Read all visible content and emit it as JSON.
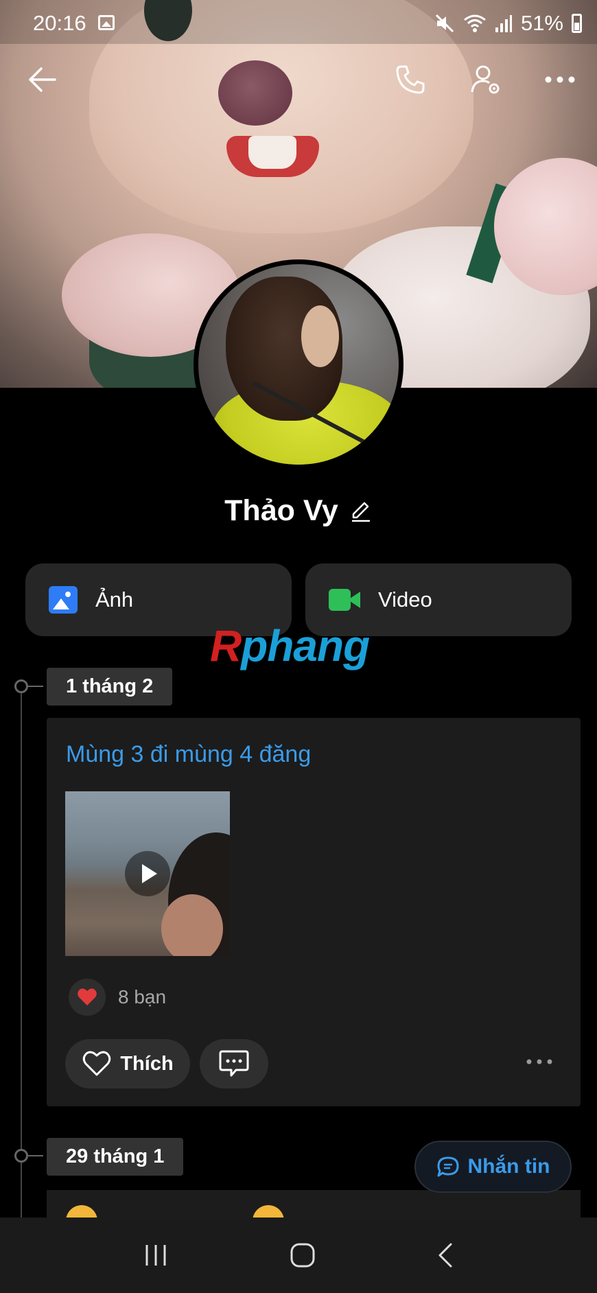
{
  "status_bar": {
    "time": "20:16",
    "battery": "51%",
    "icons": [
      "gallery-icon",
      "mute-icon",
      "wifi-icon",
      "signal-icon",
      "battery-icon"
    ]
  },
  "top_bar": {
    "icons": [
      "back-arrow-icon",
      "phone-icon",
      "user-settings-icon",
      "more-icon"
    ]
  },
  "profile": {
    "name": "Thảo Vy",
    "edit_icon": "pencil-icon"
  },
  "media_buttons": {
    "photos_label": "Ảnh",
    "videos_label": "Video",
    "photos_icon": "image-icon",
    "videos_icon": "video-camera-icon"
  },
  "watermark": {
    "first": "R",
    "rest": "phang"
  },
  "timeline": [
    {
      "date": "1 tháng 2",
      "caption": "Mùng 3 đi mùng 4 đăng",
      "media": "video",
      "reaction_count_text": "8 bạn",
      "reaction_icon": "heart-icon",
      "like_label": "Thích"
    },
    {
      "date": "29 tháng 1"
    }
  ],
  "chat_button": {
    "label": "Nhắn tin",
    "icon": "chat-bubble-icon"
  },
  "colors": {
    "background": "#000000",
    "card": "#1c1c1c",
    "accent_blue": "#3a9bea",
    "photo_blue": "#2e7cf6",
    "video_green": "#2fbf59",
    "heart_red": "#e23b3b"
  }
}
